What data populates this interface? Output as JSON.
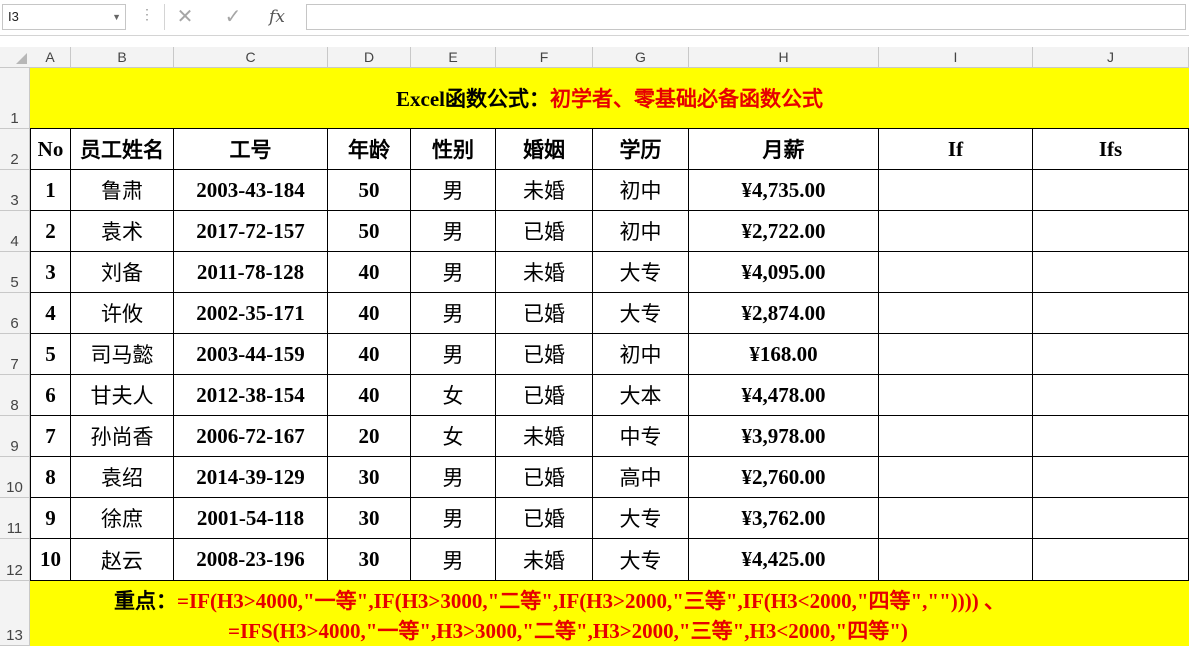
{
  "formula_bar": {
    "name_box": "I3",
    "cancel_icon": "✕",
    "enter_icon": "✓",
    "fx_label": "fx",
    "formula": ""
  },
  "columns": [
    "A",
    "B",
    "C",
    "D",
    "E",
    "F",
    "G",
    "H",
    "I",
    "J"
  ],
  "rows": [
    "1",
    "2",
    "3",
    "4",
    "5",
    "6",
    "7",
    "8",
    "9",
    "10",
    "11",
    "12",
    "13"
  ],
  "title": {
    "black": "Excel函数公式：",
    "red": "初学者、零基础必备函数公式"
  },
  "headers": [
    "No",
    "员工姓名",
    "工号",
    "年龄",
    "性别",
    "婚姻",
    "学历",
    "月薪",
    "If",
    "Ifs"
  ],
  "table": [
    [
      "1",
      "鲁肃",
      "2003-43-184",
      "50",
      "男",
      "未婚",
      "初中",
      "¥4,735.00",
      "",
      ""
    ],
    [
      "2",
      "袁术",
      "2017-72-157",
      "50",
      "男",
      "已婚",
      "初中",
      "¥2,722.00",
      "",
      ""
    ],
    [
      "3",
      "刘备",
      "2011-78-128",
      "40",
      "男",
      "未婚",
      "大专",
      "¥4,095.00",
      "",
      ""
    ],
    [
      "4",
      "许攸",
      "2002-35-171",
      "40",
      "男",
      "已婚",
      "大专",
      "¥2,874.00",
      "",
      ""
    ],
    [
      "5",
      "司马懿",
      "2003-44-159",
      "40",
      "男",
      "已婚",
      "初中",
      "¥168.00",
      "",
      ""
    ],
    [
      "6",
      "甘夫人",
      "2012-38-154",
      "40",
      "女",
      "已婚",
      "大本",
      "¥4,478.00",
      "",
      ""
    ],
    [
      "7",
      "孙尚香",
      "2006-72-167",
      "20",
      "女",
      "未婚",
      "中专",
      "¥3,978.00",
      "",
      ""
    ],
    [
      "8",
      "袁绍",
      "2014-39-129",
      "30",
      "男",
      "已婚",
      "高中",
      "¥2,760.00",
      "",
      ""
    ],
    [
      "9",
      "徐庶",
      "2001-54-118",
      "30",
      "男",
      "已婚",
      "大专",
      "¥3,762.00",
      "",
      ""
    ],
    [
      "10",
      "赵云",
      "2008-23-196",
      "30",
      "男",
      "未婚",
      "大专",
      "¥4,425.00",
      "",
      ""
    ]
  ],
  "note": {
    "key": "重点：",
    "line1": "=IF(H3>4000,\"一等\",IF(H3>3000,\"二等\",IF(H3>2000,\"三等\",IF(H3<2000,\"四等\",\"\")))) 、",
    "line2": "=IFS(H3>4000,\"一等\",H3>3000,\"二等\",H3>2000,\"三等\",H3<2000,\"四等\")"
  },
  "colors": {
    "highlight": "#ffff00",
    "accent_red": "#e60000",
    "header_bg": "#f3f3f3"
  }
}
